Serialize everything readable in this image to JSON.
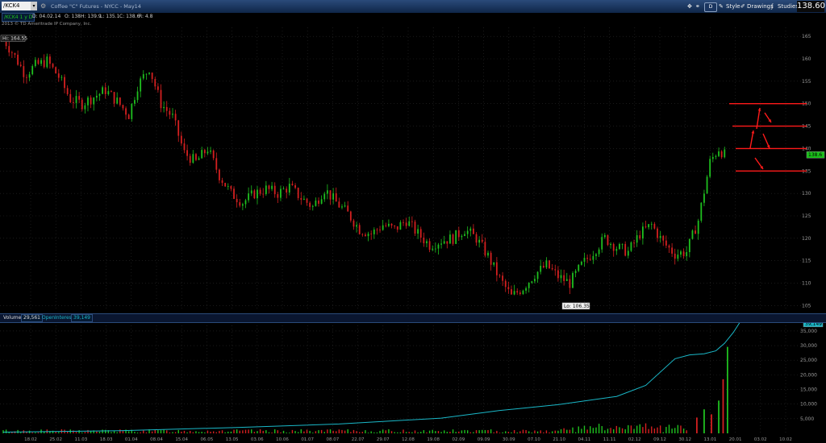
{
  "toolbar": {
    "symbol": "/KCK4",
    "title": "Coffee \"C\" Futures - NYCC - May14",
    "timeframe_button": "D",
    "style_label": "Style",
    "drawings_label": "Drawings",
    "studies_label": "Studies",
    "last_price": "138.60"
  },
  "infobar": {
    "series_label": "/KCK4 1 y D",
    "date": "D: 04.02.14",
    "open": "O: 138",
    "high": "H: 139.9",
    "low": "L: 135.1",
    "close": "C: 138.6",
    "range": "R: 4.8"
  },
  "copyright": "2013 © TD Ameritrade IP Company, Inc.",
  "annotations": {
    "hi_label": "Hi: 164.55",
    "lo_label": "Lo: 106.35",
    "price_tag": "138.6",
    "oi_tag": "39,149"
  },
  "volume_header": {
    "volume_label": "Volume",
    "volume_value": "29,561",
    "oi_label": "OpenInterest",
    "oi_value": "39,149"
  },
  "colors": {
    "up": "#1fbf1f",
    "down": "#d42020",
    "oi": "#1ab8c8",
    "level": "#ff1a1a"
  },
  "chart_data": [
    {
      "type": "candlestick",
      "name": "price",
      "ylim": [
        104,
        167
      ],
      "yticks": [
        "105",
        "110",
        "115",
        "120",
        "125",
        "130",
        "135",
        "140",
        "145",
        "150",
        "155",
        "160",
        "165"
      ],
      "ytick_values": [
        105,
        110,
        115,
        120,
        125,
        130,
        135,
        140,
        145,
        150,
        155,
        160,
        165
      ],
      "xtick_labels": [
        "18.02",
        "25.02",
        "11.03",
        "18.03",
        "01.04",
        "08.04",
        "15.04",
        "06.05",
        "13.05",
        "03.06",
        "10.06",
        "01.07",
        "08.07",
        "22.07",
        "29.07",
        "12.08",
        "19.08",
        "02.09",
        "09.09",
        "30.09",
        "07.10",
        "21.10",
        "04.11",
        "11.11",
        "02.12",
        "09.12",
        "30.12",
        "13.01",
        "20.01",
        "03.02",
        "10.02"
      ],
      "close_path": [
        [
          0,
          164.5
        ],
        [
          8,
          160.5
        ],
        [
          15,
          156.5
        ],
        [
          22,
          158.5
        ],
        [
          30,
          159.5
        ],
        [
          38,
          156
        ],
        [
          46,
          151
        ],
        [
          54,
          150
        ],
        [
          62,
          151.5
        ],
        [
          70,
          153
        ],
        [
          78,
          150.5
        ],
        [
          86,
          147.5
        ],
        [
          92,
          154
        ],
        [
          100,
          158
        ],
        [
          108,
          150
        ],
        [
          116,
          147
        ],
        [
          124,
          139
        ],
        [
          132,
          137
        ],
        [
          140,
          140
        ],
        [
          148,
          134
        ],
        [
          156,
          130
        ],
        [
          164,
          128
        ],
        [
          172,
          130
        ],
        [
          180,
          131
        ],
        [
          188,
          130
        ],
        [
          196,
          131.5
        ],
        [
          204,
          129
        ],
        [
          212,
          127
        ],
        [
          220,
          131
        ],
        [
          228,
          128
        ],
        [
          236,
          125.5
        ],
        [
          244,
          122
        ],
        [
          252,
          121
        ],
        [
          260,
          123
        ],
        [
          268,
          122
        ],
        [
          276,
          124
        ],
        [
          284,
          121
        ],
        [
          292,
          118.5
        ],
        [
          300,
          119.5
        ],
        [
          308,
          120
        ],
        [
          316,
          122
        ],
        [
          324,
          120
        ],
        [
          332,
          116
        ],
        [
          340,
          111
        ],
        [
          348,
          107
        ],
        [
          356,
          109
        ],
        [
          364,
          112
        ],
        [
          372,
          114
        ],
        [
          380,
          111.5
        ],
        [
          388,
          110
        ],
        [
          396,
          114
        ],
        [
          404,
          117
        ],
        [
          412,
          120
        ],
        [
          420,
          118
        ],
        [
          428,
          117
        ],
        [
          436,
          121
        ],
        [
          444,
          123
        ],
        [
          452,
          119
        ],
        [
          460,
          116.5
        ],
        [
          468,
          117
        ],
        [
          476,
          124
        ],
        [
          484,
          137
        ],
        [
          490,
          140
        ],
        [
          494,
          138.6
        ]
      ],
      "hi": 164.55,
      "lo": 106.35,
      "last": 138.6,
      "levels": [
        150,
        145,
        140,
        135
      ]
    },
    {
      "type": "bar+line",
      "name": "volume / open interest",
      "ylim": [
        0,
        38000
      ],
      "yticks": [
        "5,000",
        "10,000",
        "15,000",
        "20,000",
        "25,000",
        "30,000",
        "35,000"
      ],
      "ytick_values": [
        5000,
        10000,
        15000,
        20000,
        25000,
        30000,
        35000
      ],
      "open_interest": [
        [
          0,
          400
        ],
        [
          80,
          900
        ],
        [
          160,
          2000
        ],
        [
          230,
          3200
        ],
        [
          300,
          5200
        ],
        [
          340,
          7800
        ],
        [
          380,
          9800
        ],
        [
          420,
          12600
        ],
        [
          440,
          16400
        ],
        [
          460,
          25500
        ],
        [
          470,
          26800
        ],
        [
          480,
          27200
        ],
        [
          488,
          28200
        ],
        [
          494,
          30800
        ],
        [
          500,
          34500
        ],
        [
          506,
          39149
        ]
      ],
      "volume_spikes": [
        [
          475,
          5400
        ],
        [
          480,
          8200
        ],
        [
          485,
          6500
        ],
        [
          490,
          11200
        ],
        [
          493,
          18500
        ],
        [
          496,
          29561
        ]
      ]
    }
  ]
}
